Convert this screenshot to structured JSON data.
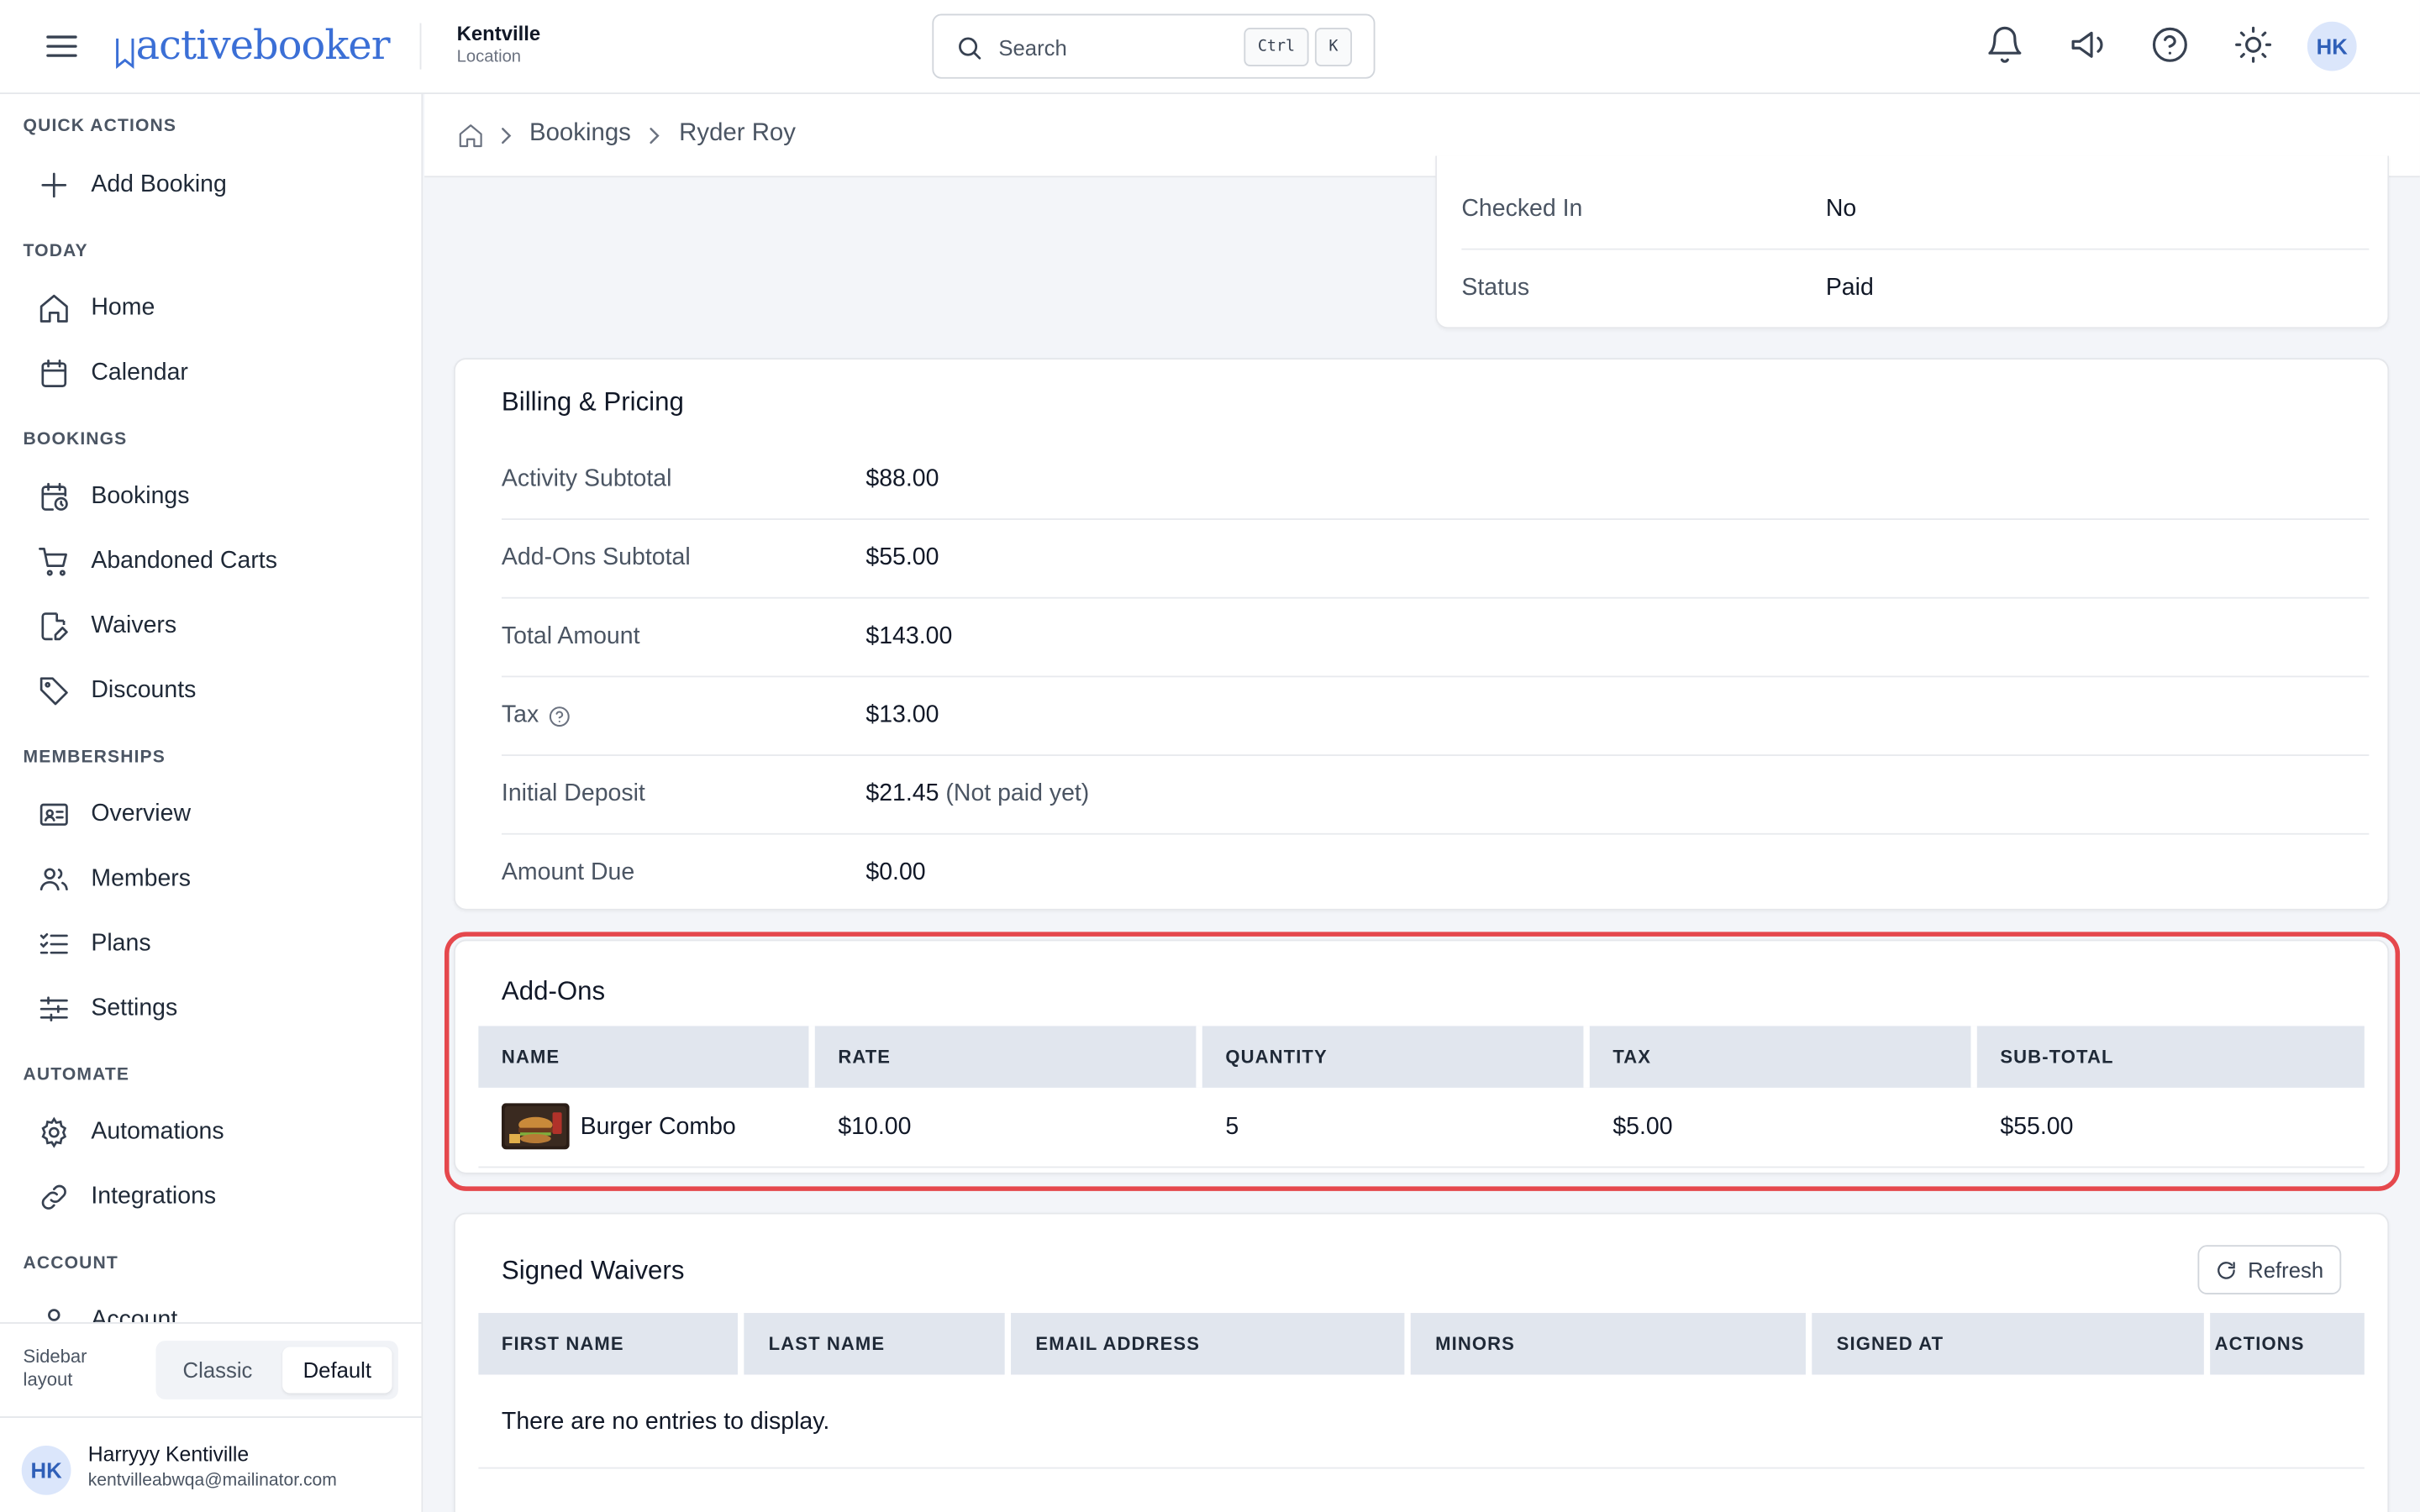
{
  "brand": {
    "logo_text": "activebooker"
  },
  "location": {
    "name": "Kentville",
    "label": "Location"
  },
  "search": {
    "placeholder": "Search",
    "kbd_ctrl": "Ctrl",
    "kbd_k": "K"
  },
  "user": {
    "initials": "HK",
    "name": "Harryyy Kentiville",
    "email": "kentvilleabwqa@mailinator.com"
  },
  "sidebar": {
    "sections": [
      {
        "title": "QUICK ACTIONS",
        "items": [
          {
            "label": "Add Booking",
            "icon": "plus-icon"
          }
        ]
      },
      {
        "title": "TODAY",
        "items": [
          {
            "label": "Home",
            "icon": "home-icon"
          },
          {
            "label": "Calendar",
            "icon": "calendar-icon"
          }
        ]
      },
      {
        "title": "BOOKINGS",
        "items": [
          {
            "label": "Bookings",
            "icon": "calendar-clock-icon"
          },
          {
            "label": "Abandoned Carts",
            "icon": "cart-icon"
          },
          {
            "label": "Waivers",
            "icon": "file-pen-icon"
          },
          {
            "label": "Discounts",
            "icon": "tag-icon"
          }
        ]
      },
      {
        "title": "MEMBERSHIPS",
        "items": [
          {
            "label": "Overview",
            "icon": "id-card-icon"
          },
          {
            "label": "Members",
            "icon": "users-icon"
          },
          {
            "label": "Plans",
            "icon": "list-check-icon"
          },
          {
            "label": "Settings",
            "icon": "sliders-icon"
          }
        ]
      },
      {
        "title": "AUTOMATE",
        "items": [
          {
            "label": "Automations",
            "icon": "gear-icon"
          },
          {
            "label": "Integrations",
            "icon": "link-icon"
          }
        ]
      },
      {
        "title": "ACCOUNT",
        "items": [
          {
            "label": "Account",
            "icon": "user-icon"
          }
        ]
      }
    ],
    "layout_label": "Sidebar layout",
    "layout_options": {
      "classic": "Classic",
      "default": "Default"
    },
    "layout_selected": "Default"
  },
  "breadcrumb": {
    "items": [
      "Bookings",
      "Ryder Roy"
    ]
  },
  "booking_status": {
    "rows": [
      {
        "label": "Checked In",
        "value": "No"
      },
      {
        "label": "Status",
        "value": "Paid"
      }
    ]
  },
  "billing": {
    "title": "Billing & Pricing",
    "rows": [
      {
        "label": "Activity Subtotal",
        "value": "$88.00"
      },
      {
        "label": "Add-Ons Subtotal",
        "value": "$55.00"
      },
      {
        "label": "Total Amount",
        "value": "$143.00"
      },
      {
        "label": "Tax",
        "value": "$13.00"
      },
      {
        "label": "Initial Deposit",
        "value": "$21.45",
        "note": "(Not paid yet)"
      },
      {
        "label": "Amount Due",
        "value": "$0.00"
      }
    ]
  },
  "addons": {
    "title": "Add-Ons",
    "columns": [
      "NAME",
      "RATE",
      "QUANTITY",
      "TAX",
      "SUB-TOTAL"
    ],
    "rows": [
      {
        "name": "Burger Combo",
        "rate": "$10.00",
        "quantity": "5",
        "tax": "$5.00",
        "subtotal": "$55.00"
      }
    ]
  },
  "waivers": {
    "title": "Signed Waivers",
    "refresh_label": "Refresh",
    "columns": [
      "FIRST NAME",
      "LAST NAME",
      "EMAIL ADDRESS",
      "MINORS",
      "SIGNED AT",
      "ACTIONS"
    ],
    "empty_text": "There are no entries to display."
  },
  "colors": {
    "accent": "#3b6fd6",
    "highlight": "#e5484d",
    "table_header": "#e1e6ee"
  }
}
